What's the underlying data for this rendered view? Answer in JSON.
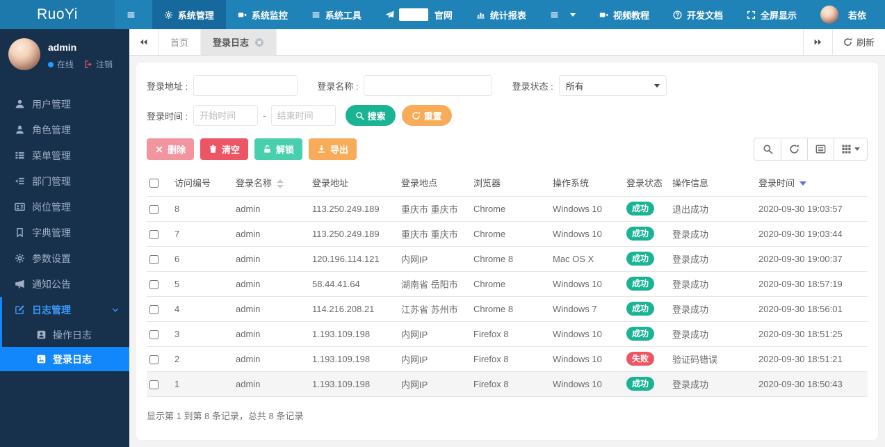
{
  "brand": {
    "name": "RuoYi"
  },
  "topnav": {
    "items": [
      {
        "name": "sidebar-toggle",
        "label": "",
        "icon": "bars"
      },
      {
        "name": "menu-system-manage",
        "label": "系统管理",
        "icon": "gear",
        "active": true
      },
      {
        "name": "menu-system-monitor",
        "label": "系统监控",
        "icon": "video"
      },
      {
        "name": "menu-system-tools",
        "label": "系统工具",
        "icon": "bars"
      },
      {
        "name": "menu-official-site",
        "label": "官网",
        "icon": "plane",
        "redacted": true
      },
      {
        "name": "menu-reports",
        "label": "统计报表",
        "icon": "chart"
      },
      {
        "name": "menu-more",
        "label": "",
        "icon": "bars",
        "caret": true
      }
    ],
    "right_items": [
      {
        "name": "nav-video-tutorial",
        "label": "视频教程",
        "icon": "video"
      },
      {
        "name": "nav-dev-docs",
        "label": "开发文档",
        "icon": "question"
      },
      {
        "name": "nav-fullscreen",
        "label": "全屏显示",
        "icon": "expand"
      }
    ],
    "user": {
      "name": "若依"
    }
  },
  "sidebar": {
    "username": "admin",
    "status": "在线",
    "logout": "注销",
    "items": [
      {
        "name": "sidebar-item-user-manage",
        "label": "用户管理",
        "icon": "user"
      },
      {
        "name": "sidebar-item-role-manage",
        "label": "角色管理",
        "icon": "role"
      },
      {
        "name": "sidebar-item-menu-manage",
        "label": "菜单管理",
        "icon": "thlist"
      },
      {
        "name": "sidebar-item-dept-manage",
        "label": "部门管理",
        "icon": "outdent"
      },
      {
        "name": "sidebar-item-post-manage",
        "label": "岗位管理",
        "icon": "card"
      },
      {
        "name": "sidebar-item-dict-manage",
        "label": "字典管理",
        "icon": "bookmark"
      },
      {
        "name": "sidebar-item-param-config",
        "label": "参数设置",
        "icon": "gear"
      },
      {
        "name": "sidebar-item-notice",
        "label": "通知公告",
        "icon": "horn"
      },
      {
        "name": "sidebar-item-log-manage",
        "label": "日志管理",
        "icon": "edit",
        "expanded": true,
        "children": [
          {
            "name": "sidebar-item-oper-log",
            "label": "操作日志",
            "icon": "docuser"
          },
          {
            "name": "sidebar-item-login-log",
            "label": "登录日志",
            "icon": "docimg",
            "active": true
          }
        ]
      }
    ]
  },
  "tabs": {
    "home": "首页",
    "active": "登录日志",
    "refresh": "刷新"
  },
  "filters": {
    "addr_label": "登录地址 :",
    "name_label": "登录名称 :",
    "status_label": "登录状态 :",
    "status_value": "所有",
    "time_label": "登录时间 :",
    "time_start_ph": "开始时间",
    "time_sep": "-",
    "time_end_ph": "结束时间",
    "search_btn": "搜索",
    "reset_btn": "重置"
  },
  "toolbar": {
    "delete": "删除",
    "clean": "清空",
    "unlock": "解锁",
    "export": "导出"
  },
  "table": {
    "columns": [
      {
        "label": "访问编号"
      },
      {
        "label": "登录名称",
        "sort": "both"
      },
      {
        "label": "登录地址"
      },
      {
        "label": "登录地点"
      },
      {
        "label": "浏览器"
      },
      {
        "label": "操作系统"
      },
      {
        "label": "登录状态"
      },
      {
        "label": "操作信息"
      },
      {
        "label": "登录时间",
        "sort": "desc"
      }
    ],
    "rows": [
      {
        "id": "8",
        "user": "admin",
        "ip": "113.250.249.189",
        "location": "重庆市 重庆市",
        "browser": "Chrome",
        "os": "Windows 10",
        "status": {
          "label": "成功",
          "type": "success"
        },
        "msg": "退出成功",
        "time": "2020-09-30 19:03:57"
      },
      {
        "id": "7",
        "user": "admin",
        "ip": "113.250.249.189",
        "location": "重庆市 重庆市",
        "browser": "Chrome",
        "os": "Windows 10",
        "status": {
          "label": "成功",
          "type": "success"
        },
        "msg": "登录成功",
        "time": "2020-09-30 19:03:44"
      },
      {
        "id": "6",
        "user": "admin",
        "ip": "120.196.114.121",
        "location": "内网IP",
        "browser": "Chrome 8",
        "os": "Mac OS X",
        "status": {
          "label": "成功",
          "type": "success"
        },
        "msg": "登录成功",
        "time": "2020-09-30 19:00:37"
      },
      {
        "id": "5",
        "user": "admin",
        "ip": "58.44.41.64",
        "location": "湖南省 岳阳市",
        "browser": "Chrome",
        "os": "Windows 10",
        "status": {
          "label": "成功",
          "type": "success"
        },
        "msg": "登录成功",
        "time": "2020-09-30 18:57:19"
      },
      {
        "id": "4",
        "user": "admin",
        "ip": "114.216.208.21",
        "location": "江苏省 苏州市",
        "browser": "Chrome 8",
        "os": "Windows 7",
        "status": {
          "label": "成功",
          "type": "success"
        },
        "msg": "登录成功",
        "time": "2020-09-30 18:56:01"
      },
      {
        "id": "3",
        "user": "admin",
        "ip": "1.193.109.198",
        "location": "内网IP",
        "browser": "Firefox 8",
        "os": "Windows 10",
        "status": {
          "label": "成功",
          "type": "success"
        },
        "msg": "登录成功",
        "time": "2020-09-30 18:51:25"
      },
      {
        "id": "2",
        "user": "admin",
        "ip": "1.193.109.198",
        "location": "内网IP",
        "browser": "Firefox 8",
        "os": "Windows 10",
        "status": {
          "label": "失败",
          "type": "danger"
        },
        "msg": "验证码错误",
        "time": "2020-09-30 18:51:21"
      },
      {
        "id": "1",
        "user": "admin",
        "ip": "1.193.109.198",
        "location": "内网IP",
        "browser": "Firefox 8",
        "os": "Windows 10",
        "status": {
          "label": "成功",
          "type": "success"
        },
        "msg": "登录成功",
        "time": "2020-09-30 18:50:43",
        "highlight": true
      }
    ]
  },
  "pagination": {
    "summary": "显示第 1 到第 8 条记录，总共 8 条记录"
  },
  "colors": {
    "navbar": "#2083b8",
    "navbar_active": "#15699c",
    "sidebar": "#17304c",
    "active_blue": "#1287fb",
    "success": "#1ab394",
    "danger": "#ed5565",
    "orange": "#f8ac59",
    "mint": "#48cfad"
  }
}
